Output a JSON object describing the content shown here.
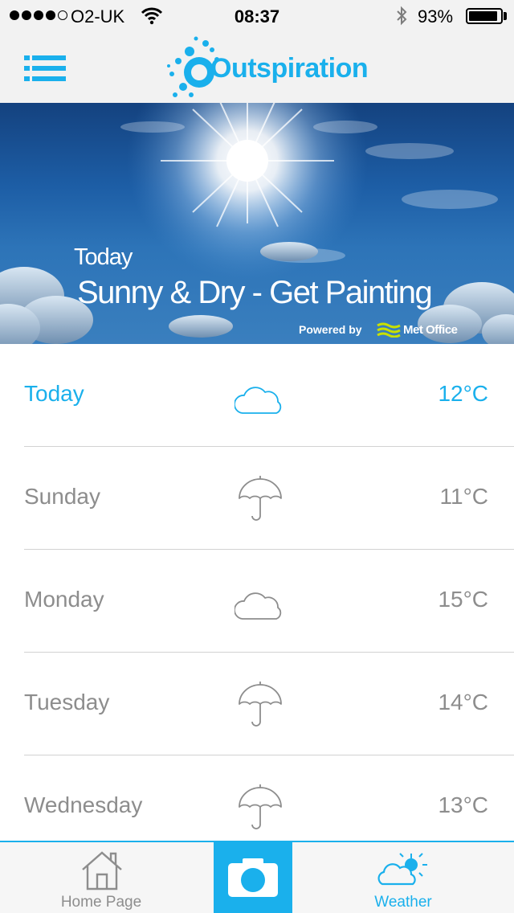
{
  "status_bar": {
    "carrier": "O2-UK",
    "time": "08:37",
    "battery_percent_label": "93%",
    "battery_level": 0.93
  },
  "header": {
    "logo_text": "Outspiration",
    "menu_icon": "list-icon"
  },
  "hero": {
    "day": "Today",
    "forecast": "Sunny & Dry - Get Painting",
    "powered_by": "Powered by",
    "provider": "Met Office"
  },
  "forecast": [
    {
      "day": "Today",
      "icon": "cloud-icon",
      "temp": "12°C",
      "active": true
    },
    {
      "day": "Sunday",
      "icon": "umbrella-icon",
      "temp": "11°C",
      "active": false
    },
    {
      "day": "Monday",
      "icon": "cloud-icon",
      "temp": "15°C",
      "active": false
    },
    {
      "day": "Tuesday",
      "icon": "umbrella-icon",
      "temp": "14°C",
      "active": false
    },
    {
      "day": "Wednesday",
      "icon": "umbrella-icon",
      "temp": "13°C",
      "active": false
    }
  ],
  "tab_bar": {
    "home_label": "Home Page",
    "camera_icon": "camera-icon",
    "weather_label": "Weather",
    "active_tab": "Weather"
  },
  "colors": {
    "accent": "#1ab0ec",
    "muted_text": "#8d8d8d",
    "bar_background": "#f2f2f2",
    "divider": "#d2d2d2"
  }
}
